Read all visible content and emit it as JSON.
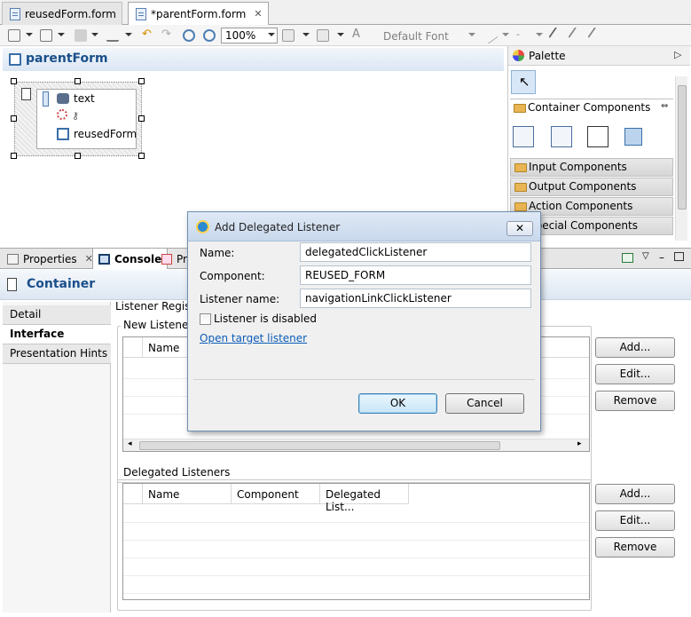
{
  "editor_tabs": [
    {
      "label": "reusedForm.form",
      "active": false
    },
    {
      "label": "*parentForm.form",
      "active": true
    }
  ],
  "toolbar": {
    "zoom": "100%",
    "font": "Default Font",
    "dash": "-"
  },
  "editor": {
    "title": "parentForm",
    "widget_labels": [
      "text",
      "reusedForm"
    ]
  },
  "palette": {
    "title": "Palette",
    "categories": [
      "Container Components",
      "Input Components",
      "Output Components",
      "Action Components",
      "Special Components"
    ]
  },
  "views": {
    "tabs": [
      "Properties",
      "Console",
      "Pr"
    ]
  },
  "properties": {
    "title": "Container",
    "side_tabs": [
      "Detail",
      "Interface",
      "Presentation Hints"
    ],
    "registration_label": "Listener Registrat",
    "new_listeners": {
      "title": "New Listeners",
      "columns": [
        "Name"
      ]
    },
    "delegated_listeners": {
      "title": "Delegated Listeners",
      "columns": [
        "Name",
        "Component",
        "Delegated List..."
      ]
    },
    "buttons": {
      "add": "Add...",
      "edit": "Edit...",
      "remove": "Remove"
    }
  },
  "dialog": {
    "title": "Add Delegated Listener",
    "fields": [
      {
        "label": "Name:",
        "value": "delegatedClickListener"
      },
      {
        "label": "Component:",
        "value": "REUSED_FORM"
      },
      {
        "label": "Listener name:",
        "value": "navigationLinkClickListener"
      }
    ],
    "checkbox_label": "Listener is disabled",
    "checkbox_checked": false,
    "link": "Open target listener",
    "ok": "OK",
    "cancel": "Cancel"
  },
  "colors": {
    "accent": "#1a4f8b",
    "link": "#0b5cb8",
    "default_button": "#3c7fb1"
  }
}
